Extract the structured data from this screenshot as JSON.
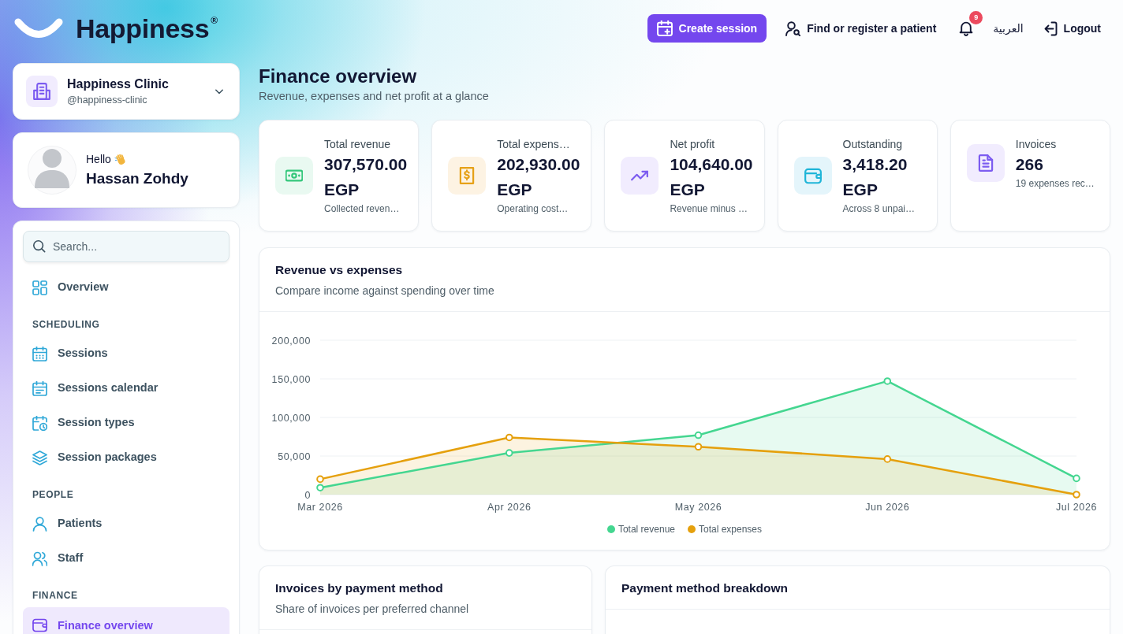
{
  "header": {
    "logo": "Happiness$^{®}$",
    "create_button": "Create session",
    "find_patient": "Find or register a patient",
    "notification_count": "9",
    "language": "العربية",
    "logout": "Logout"
  },
  "clinic": {
    "name": "Happiness Clinic",
    "handle": "@happiness-clinic"
  },
  "user": {
    "greeting": "Hello",
    "name": "Hassan Zohdy"
  },
  "sidebar": {
    "search": {
      "placeholder": "Search..."
    },
    "groups": [
      {
        "items": [
          {
            "label": "Overview",
            "selected": false
          }
        ]
      },
      {
        "heading": "SCHEDULING",
        "items": [
          {
            "label": "Sessions",
            "selected": false
          },
          {
            "label": "Sessions calendar",
            "selected": false
          },
          {
            "label": "Session types",
            "selected": false
          },
          {
            "label": "Session packages",
            "selected": false
          }
        ]
      },
      {
        "heading": "PEOPLE",
        "items": [
          {
            "label": "Patients",
            "selected": false
          },
          {
            "label": "Staff",
            "selected": false
          }
        ]
      },
      {
        "heading": "FINANCE",
        "items": [
          {
            "label": "Finance overview",
            "selected": true
          }
        ]
      }
    ]
  },
  "page": {
    "title": "Finance overview",
    "subtitle": "Revenue, expenses and net profit at a glance"
  },
  "stats": [
    {
      "label": "Total revenue",
      "value": "307,570.00 EGP",
      "note": "Collected reven…"
    },
    {
      "label": "Total expens…",
      "value": "202,930.00 EGP",
      "note": "Operating cost…"
    },
    {
      "label": "Net profit",
      "value": "104,640.00 EGP",
      "note": "Revenue minus …"
    },
    {
      "label": "Outstanding",
      "value": "3,418.20 EGP",
      "note": "Across 8 unpai…"
    },
    {
      "label": "Invoices",
      "value": "266",
      "note": "19 expenses rec…"
    }
  ],
  "revenue_chart": {
    "title": "Revenue vs expenses",
    "subtitle": "Compare income against spending over time",
    "chart_data": {
      "type": "area",
      "categories": [
        "Mar 2026",
        "Apr 2026",
        "May 2026",
        "Jun 2026",
        "Jul 2026"
      ],
      "series": [
        {
          "name": "Total revenue",
          "color": "#44d690",
          "values": [
            9000,
            54000,
            77000,
            147000,
            21000
          ]
        },
        {
          "name": "Total expenses",
          "color": "#e5a00d",
          "values": [
            20000,
            74000,
            62000,
            46000,
            0
          ]
        }
      ],
      "ylim": [
        0,
        200000
      ],
      "yticks": [
        {
          "value": 0,
          "label": "0"
        },
        {
          "value": 50000,
          "label": "50,000"
        },
        {
          "value": 100000,
          "label": "100,000"
        },
        {
          "value": 150000,
          "label": "150,000"
        },
        {
          "value": 200000,
          "label": "200,000"
        }
      ],
      "grid": true,
      "legend": "bottom"
    }
  },
  "panels": [
    {
      "title": "Invoices by payment method",
      "subtitle": "Share of invoices per preferred channel"
    },
    {
      "title": "Payment method breakdown"
    }
  ]
}
